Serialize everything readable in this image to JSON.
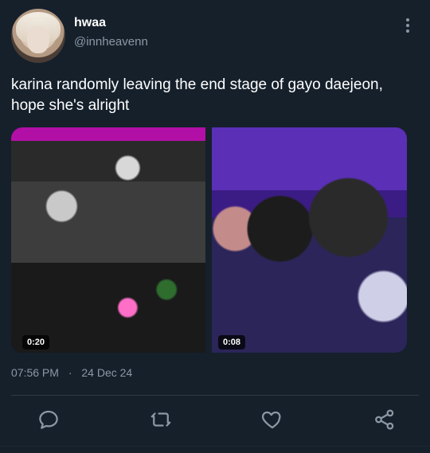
{
  "author": {
    "display_name": "hwaa",
    "handle": "@innheavenn"
  },
  "tweet": {
    "text": "karina randomly leaving the end stage of gayo daejeon, hope she's alright",
    "time": "07:56 PM",
    "date": "24 Dec 24"
  },
  "media": {
    "videos": [
      {
        "duration": "0:20"
      },
      {
        "duration": "0:08"
      }
    ]
  },
  "icons": {
    "more": "more-vertical-icon",
    "reply": "reply-icon",
    "retweet": "retweet-icon",
    "like": "heart-icon",
    "share": "share-icon"
  },
  "colors": {
    "background": "#15202b",
    "secondary_text": "#8b98a5",
    "separator": "#2f3b47"
  }
}
